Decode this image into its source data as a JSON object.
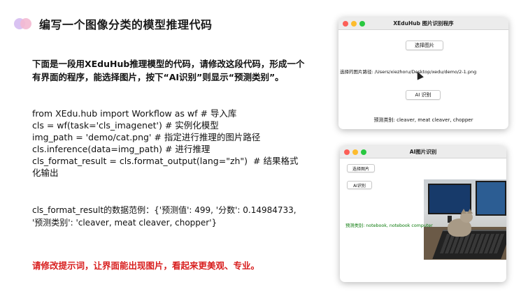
{
  "slide": {
    "title": "编写一个图像分类的模型推理代码",
    "intro": "下面是一段用XEduHub推理模型的代码，请修改这段代码，形成一个有界面的程序，能选择图片，按下“AI识别”则显示“预测类别”。",
    "code_lines": [
      "from XEdu.hub import Workflow as wf # 导入库",
      "cls = wf(task='cls_imagenet') # 实例化模型",
      "img_path = 'demo/cat.png' # 指定进行推理的图片路径",
      "cls.inference(data=img_path) # 进行推理",
      "cls_format_result = cls.format_output(lang=\"zh\")  # 结果格式化输出"
    ],
    "example": "cls_format_result的数据范例：{'预测值': 499, '分数': 0.14984733, '预测类别': 'cleaver, meat cleaver, chopper'}",
    "request": "请修改提示词，让界面能出现图片，看起来更美观、专业。"
  },
  "window1": {
    "title": "XEduHub 图片识别程序",
    "select_button": "选择图片",
    "path_text": "选择的图片路径: /Users/xiezhoru/Desktop/xedu/demo/2-1.png",
    "ai_button": "AI 识别",
    "result_text": "预测类别: cleaver, meat cleaver, chopper"
  },
  "window2": {
    "title": "AI图片识别",
    "select_button": "选择图片",
    "ai_button": "AI识别",
    "result_text": "预测类别: notebook, notebook computer"
  },
  "colors": {
    "request_red": "#d81e1e",
    "result_green": "#0b7a0b",
    "traffic_red": "#fc5f57",
    "traffic_yellow": "#fdbc2e",
    "traffic_green": "#29c840"
  }
}
